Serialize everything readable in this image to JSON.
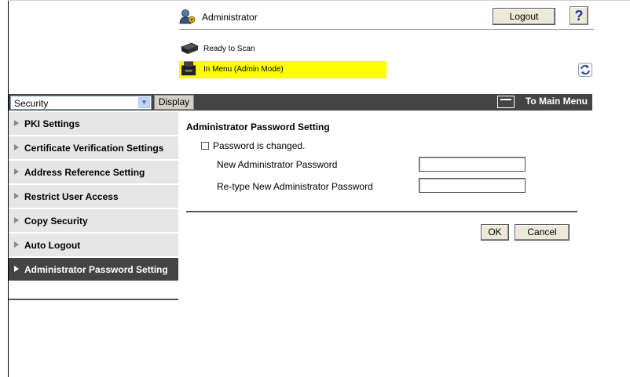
{
  "header": {
    "user_label": "Administrator",
    "logout_label": "Logout",
    "help_label": "?"
  },
  "status": {
    "scan_status": "Ready to Scan",
    "menu_status": "In Menu (Admin Mode)",
    "highlight_color": "#ffff00"
  },
  "menubar": {
    "category_selected": "Security",
    "display_label": "Display",
    "main_menu_label": "To Main Menu",
    "bar_color": "#444444"
  },
  "sidebar": {
    "items": [
      {
        "label": "PKI Settings",
        "active": false
      },
      {
        "label": "Certificate Verification Settings",
        "active": false
      },
      {
        "label": "Address Reference Setting",
        "active": false
      },
      {
        "label": "Restrict User Access",
        "active": false
      },
      {
        "label": "Copy Security",
        "active": false
      },
      {
        "label": "Auto Logout",
        "active": false
      },
      {
        "label": "Administrator Password Setting",
        "active": true
      }
    ]
  },
  "main": {
    "title": "Administrator Password Setting",
    "checkbox_label": "Password is changed.",
    "new_password_label": "New Administrator Password",
    "retype_password_label": "Re-type New Administrator Password",
    "ok_label": "OK",
    "cancel_label": "Cancel"
  }
}
